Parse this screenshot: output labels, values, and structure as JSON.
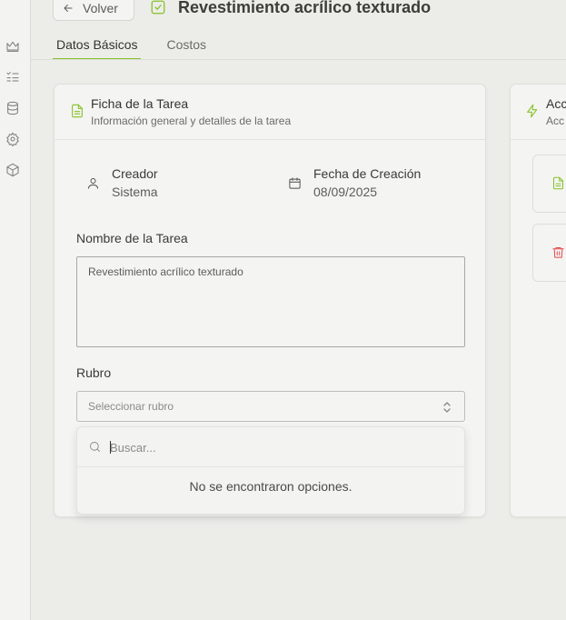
{
  "header": {
    "back_label": "Volver",
    "title": "Revestimiento acrílico texturado"
  },
  "tabs": [
    {
      "label": "Datos Básicos",
      "active": true
    },
    {
      "label": "Costos",
      "active": false
    }
  ],
  "sidebar": {
    "icons": [
      "crown-icon",
      "list-check-icon",
      "database-icon",
      "gear-icon",
      "package-icon"
    ]
  },
  "main_card": {
    "title": "Ficha de la Tarea",
    "subtitle": "Información general y detalles de la tarea",
    "creator_label": "Creador",
    "creator_value": "Sistema",
    "date_label": "Fecha de Creación",
    "date_value": "08/09/2025",
    "name_label": "Nombre de la Tarea",
    "name_value": "Revestimiento acrílico texturado",
    "category_label": "Rubro",
    "category_placeholder": "Seleccionar rubro",
    "dropdown": {
      "search_placeholder": "Buscar...",
      "empty_text": "No se encontraron opciones."
    }
  },
  "side_card": {
    "title": "Acc",
    "subtitle": "Acc"
  },
  "colors": {
    "accent": "#84c225",
    "danger": "#e5484d",
    "background": "#ecece9",
    "card": "#f4f4f2"
  }
}
